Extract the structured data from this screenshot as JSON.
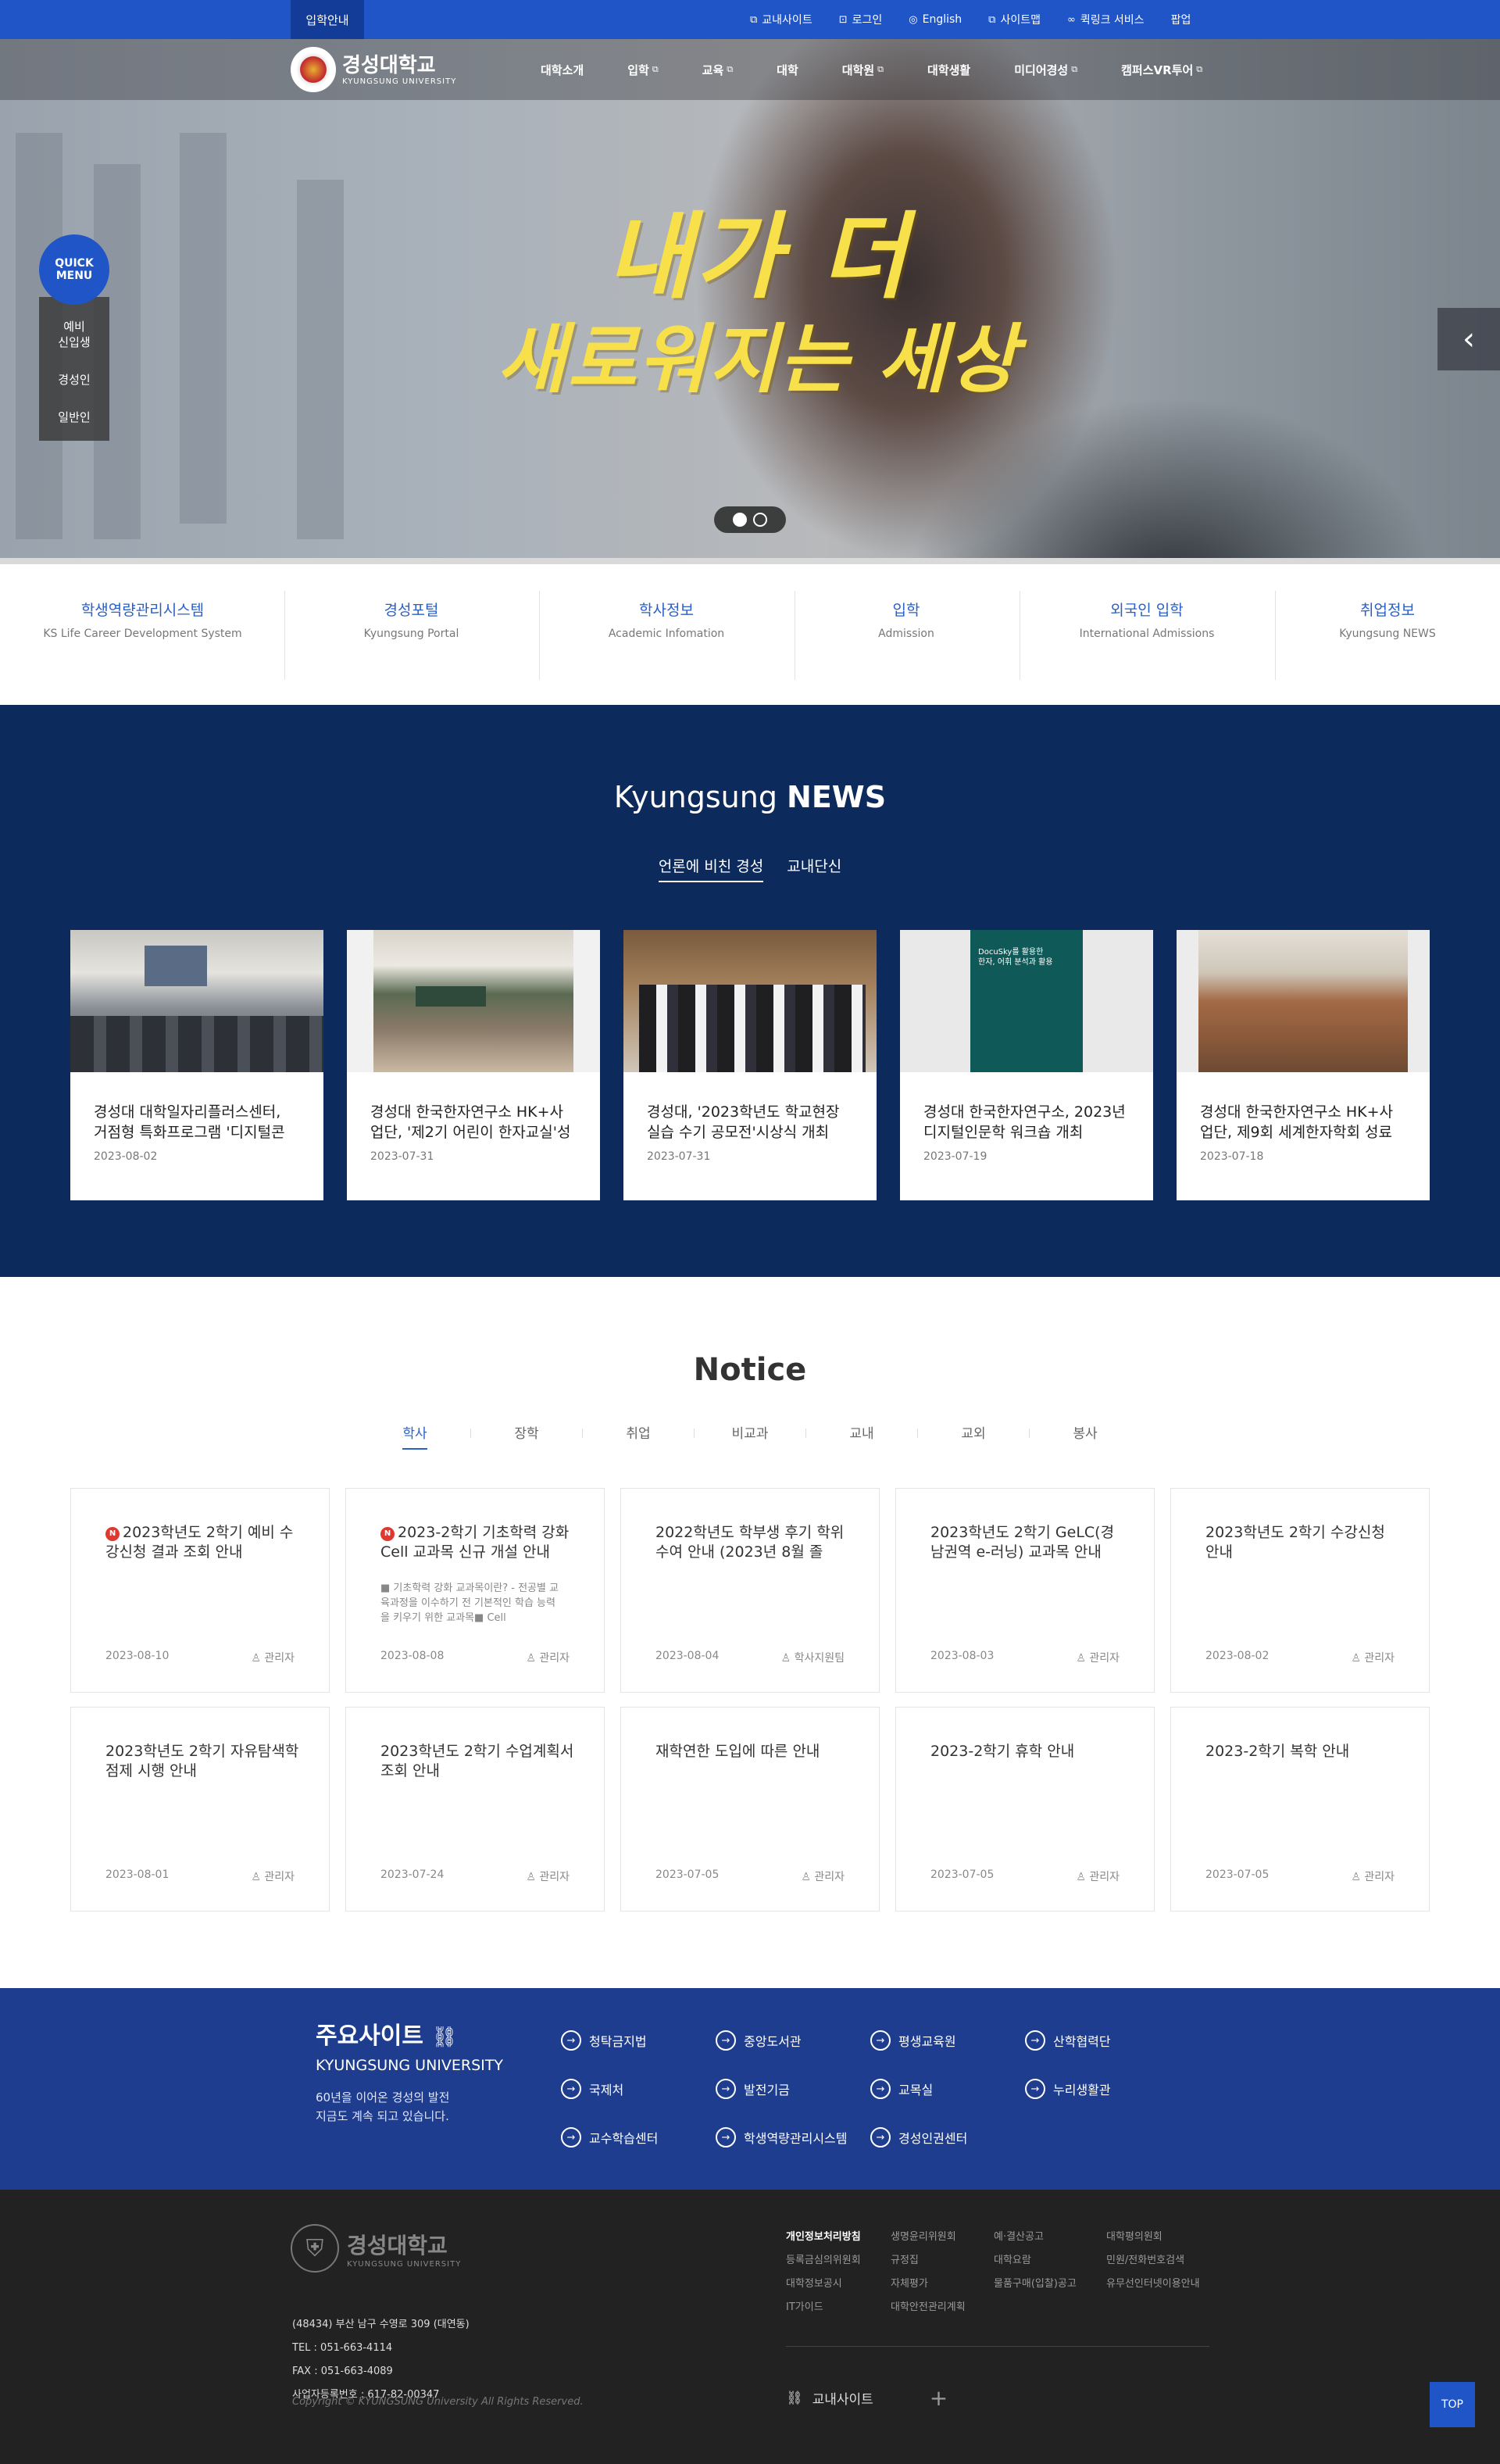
{
  "topbar": {
    "admission": "입학안내",
    "util": [
      {
        "icon": "external-link-icon",
        "glyph": "⧉",
        "label": "교내사이트"
      },
      {
        "icon": "lock-icon",
        "glyph": "🔒",
        "label": "로그인"
      },
      {
        "icon": "globe-icon",
        "glyph": "◎",
        "label": "English"
      },
      {
        "icon": "sitemap-icon",
        "glyph": "⧉",
        "label": "사이트맵"
      },
      {
        "icon": "link-icon",
        "glyph": "⛓",
        "label": "퀵링크 서비스"
      },
      {
        "icon": "",
        "glyph": "",
        "label": "팝업"
      }
    ]
  },
  "header": {
    "logo_ko": "경성대학교",
    "logo_en": "KYUNGSUNG UNIVERSITY",
    "gnb": [
      {
        "label": "대학소개",
        "ext": false
      },
      {
        "label": "입학",
        "ext": true
      },
      {
        "label": "교육",
        "ext": true
      },
      {
        "label": "대학",
        "ext": false
      },
      {
        "label": "대학원",
        "ext": true
      },
      {
        "label": "대학생활",
        "ext": false
      },
      {
        "label": "미디어경성",
        "ext": true
      },
      {
        "label": "캠퍼스VR투어",
        "ext": true
      }
    ]
  },
  "hero": {
    "line1": "내가 더",
    "line2": "새로워지는 세상",
    "quick_menu": "QUICK MENU",
    "quick_items": [
      "예비\n신입생",
      "경성인",
      "일반인"
    ]
  },
  "systems": [
    {
      "ko": "학생역량관리시스템",
      "en": "KS Life Career Development System"
    },
    {
      "ko": "경성포털",
      "en": "Kyungsung Portal"
    },
    {
      "ko": "학사정보",
      "en": "Academic Infomation"
    },
    {
      "ko": "입학",
      "en": "Admission"
    },
    {
      "ko": "외국인 입학",
      "en": "International Admissions"
    },
    {
      "ko": "취업정보",
      "en": "Kyungsung NEWS"
    }
  ],
  "news": {
    "title_light": "Kyungsung ",
    "title_bold": "NEWS",
    "tabs": [
      "언론에 비친 경성",
      "교내단신"
    ],
    "cards": [
      {
        "l1": "경성대 대학일자리플러스센터,",
        "l2": "거점형 특화프로그램 '디지털콘",
        "date": "2023-08-02"
      },
      {
        "l1": "경성대 한국한자연구소 HK+사",
        "l2": "업단, '제2기 어린이 한자교실'성",
        "date": "2023-07-31"
      },
      {
        "l1": "경성대, '2023학년도 학교현장",
        "l2": "실습 수기 공모전'시상식 개최",
        "date": "2023-07-31"
      },
      {
        "l1": "경성대 한국한자연구소, 2023년",
        "l2": "디지털인문학 워크숍 개최",
        "date": "2023-07-19"
      },
      {
        "l1": "경성대 한국한자연구소 HK+사",
        "l2": "업단, 제9회 세계한자학회 성료",
        "date": "2023-07-18"
      }
    ],
    "poster_text": "DocuSky를 활용한\n한자, 어휘 분석과 활용"
  },
  "notice": {
    "title": "Notice",
    "tabs": [
      "학사",
      "장학",
      "취업",
      "비교과",
      "교내",
      "교외",
      "봉사"
    ],
    "items": [
      {
        "hot": true,
        "title": "2023학년도 2학기 예비 수강신청 결과 조회 안내",
        "desc": "",
        "date": "2023-08-10",
        "writer": "관리자"
      },
      {
        "hot": true,
        "title": "2023-2학기 기초학력 강화 Cell 교과목 신규 개설 안내",
        "desc": "■ 기초학력 강화 교과목이란? - 전공별 교육과정을 이수하기 전 기본적인 학습 능력을 키우기 위한 교과목■ Cell",
        "date": "2023-08-08",
        "writer": "관리자"
      },
      {
        "hot": false,
        "title": "2022학년도 학부생 후기 학위수여 안내 (2023년 8월 졸",
        "desc": "",
        "date": "2023-08-04",
        "writer": "학사지원팀"
      },
      {
        "hot": false,
        "title": "2023학년도 2학기 GeLC(경남권역 e-러닝) 교과목 안내",
        "desc": "",
        "date": "2023-08-03",
        "writer": "관리자"
      },
      {
        "hot": false,
        "title": "2023학년도 2학기 수강신청 안내",
        "desc": "",
        "date": "2023-08-02",
        "writer": "관리자"
      },
      {
        "hot": false,
        "title": "2023학년도 2학기 자유탐색학점제 시행 안내",
        "desc": "",
        "date": "2023-08-01",
        "writer": "관리자"
      },
      {
        "hot": false,
        "title": "2023학년도 2학기 수업계획서 조회 안내",
        "desc": "",
        "date": "2023-07-24",
        "writer": "관리자"
      },
      {
        "hot": false,
        "title": "재학연한 도입에 따른 안내",
        "desc": "",
        "date": "2023-07-05",
        "writer": "관리자"
      },
      {
        "hot": false,
        "title": "2023-2학기 휴학 안내",
        "desc": "",
        "date": "2023-07-05",
        "writer": "관리자"
      },
      {
        "hot": false,
        "title": "2023-2학기 복학 안내",
        "desc": "",
        "date": "2023-07-05",
        "writer": "관리자"
      }
    ]
  },
  "major": {
    "title": "주요사이트",
    "subtitle": "KYUNGSUNG UNIVERSITY",
    "desc1": "60년을 이어온 경성의 발전",
    "desc2": "지금도 계속 되고 있습니다.",
    "links": [
      "청탁금지법",
      "중앙도서관",
      "평생교육원",
      "산학협력단",
      "국제처",
      "발전기금",
      "교목실",
      "누리생활관",
      "교수학습센터",
      "학생역량관리시스템",
      "경성인권센터"
    ]
  },
  "footer": {
    "logo_ko": "경성대학교",
    "logo_en": "KYUNGSUNG UNIVERSITY",
    "address": "(48434) 부산 남구 수영로 309 (대연동)",
    "tel": "TEL : 051-663-4114",
    "fax": "FAX : 051-663-4089",
    "biz": "사업자등록번호 : 617-82-00347",
    "copyright": "Copyright © KYUNGSUNG University All Rights Reserved.",
    "links": [
      [
        "개인정보처리방침",
        "등록금심의위원회",
        "대학정보공시",
        "IT가이드"
      ],
      [
        "생명윤리위원회",
        "규정집",
        "자체평가",
        "대학안전관리계획"
      ],
      [
        "예·결산공고",
        "대학요람",
        "물품구매(입찰)공고"
      ],
      [
        "대학평의원회",
        "민원/전화번호검색",
        "유무선인터넷이용안내"
      ]
    ],
    "family": "교내사이트",
    "top": "TOP"
  }
}
